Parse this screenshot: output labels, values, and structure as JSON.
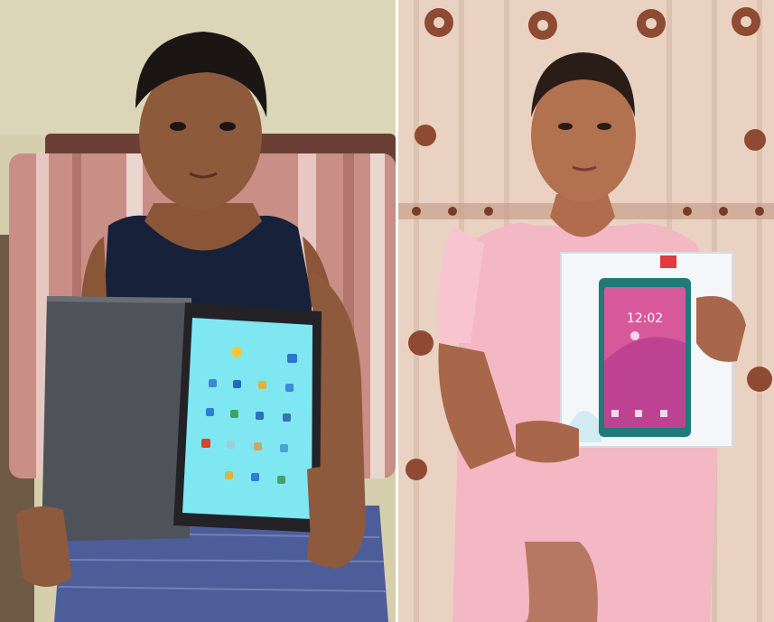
{
  "collage": {
    "layout": "two-photos-side-by-side",
    "left_photo": {
      "subject": "boy-holding-tablet",
      "tablet_screen": "app-grid",
      "palette": {
        "wall": "#d9d3b4",
        "cushion": "#c98e86",
        "shirt": "#17213a",
        "shorts": "#4d5d9a",
        "cover": "#4f5259",
        "screen": "#7fe7f2"
      }
    },
    "right_photo": {
      "subject": "girl-holding-tablet-box",
      "tablet_screen": "lock-screen",
      "clock_text": "12:02",
      "palette": {
        "curtain": "#e9d2c2",
        "dress": "#f4b7c4",
        "box": "#f5f6fa",
        "screen": "#d8589c"
      }
    }
  }
}
